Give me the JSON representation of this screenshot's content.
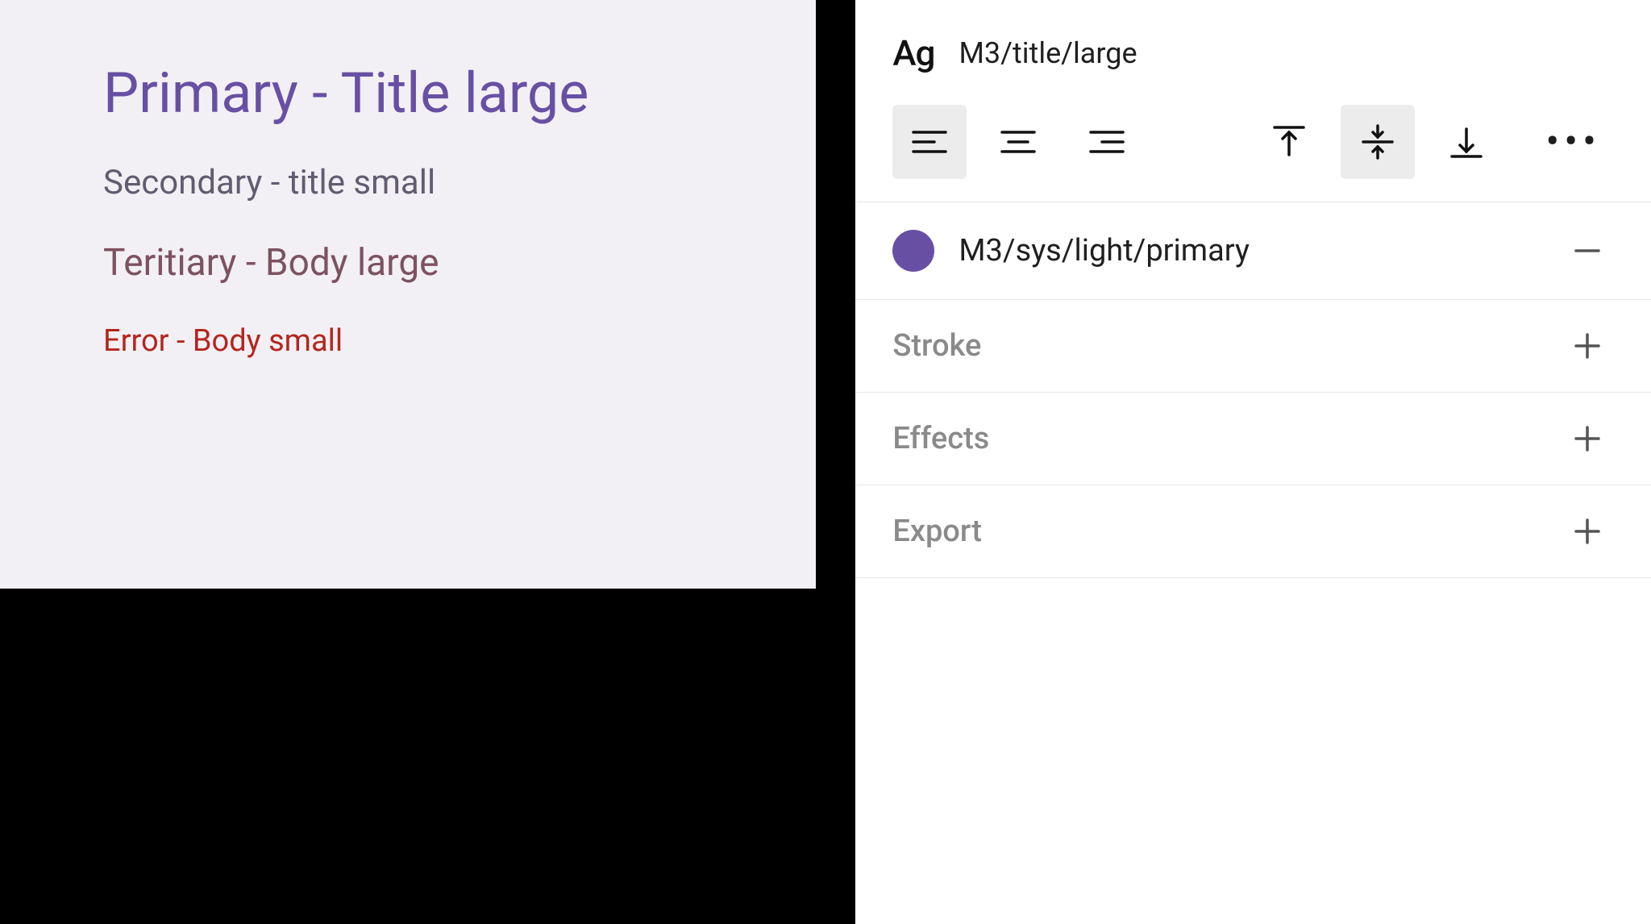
{
  "canvas": {
    "primary": "Primary - Title large",
    "secondary": "Secondary - title small",
    "tertiary": "Teritiary - Body large",
    "error": "Error - Body small"
  },
  "inspector": {
    "text_style": {
      "ag": "Ag",
      "name": "M3/title/large"
    },
    "fill": {
      "color": "#6750a4",
      "name": "M3/sys/light/primary"
    },
    "sections": {
      "stroke": "Stroke",
      "effects": "Effects",
      "export": "Export"
    }
  }
}
